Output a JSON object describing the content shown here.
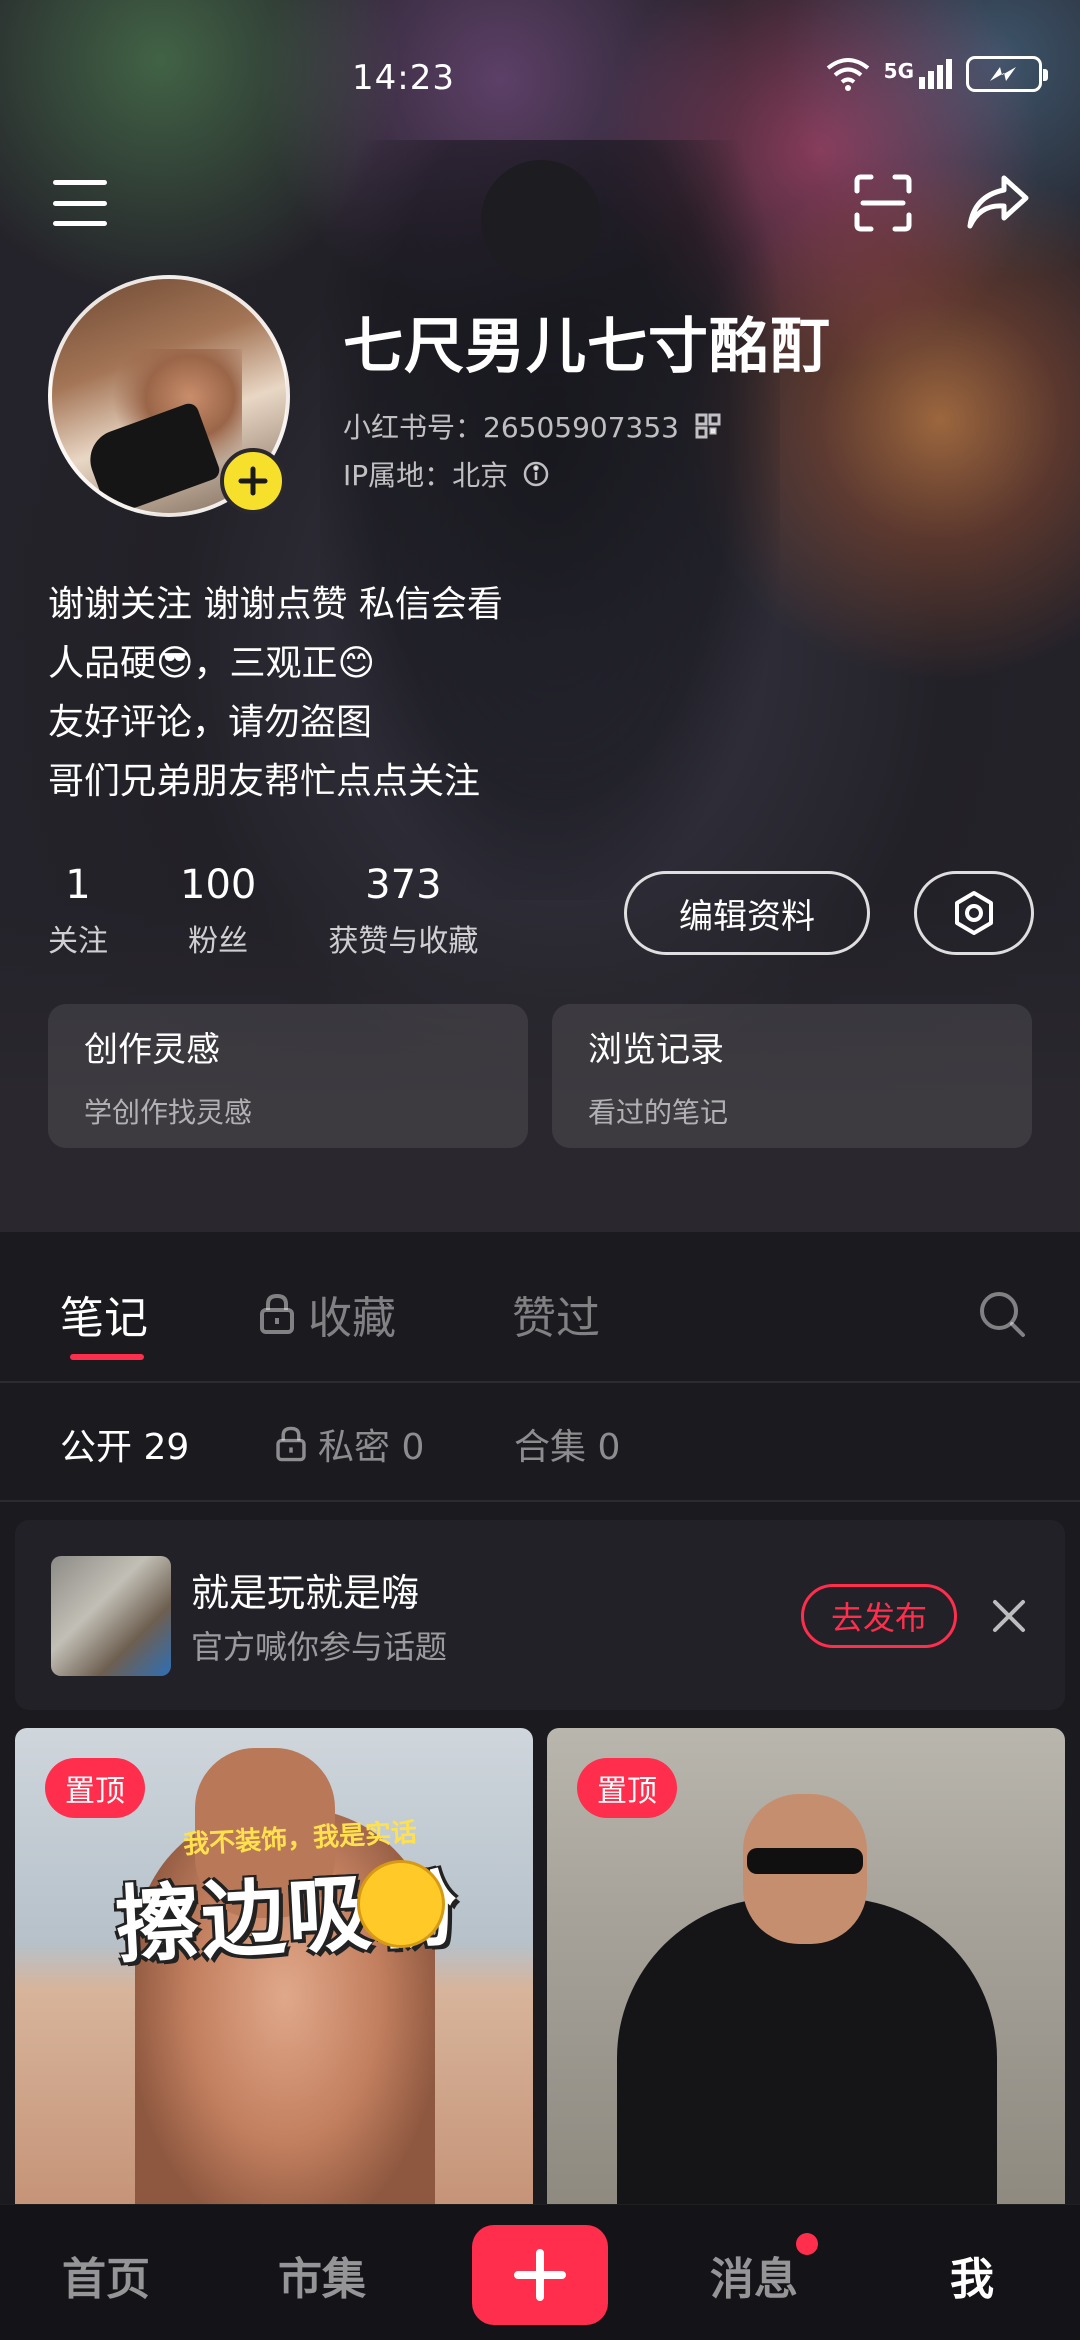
{
  "status_bar": {
    "time": "14:23",
    "network": "5G"
  },
  "profile": {
    "nickname": "七尺男儿七寸酩酊",
    "uid_label": "小红书号：26505907353",
    "ip_label": "IP属地：北京",
    "bio": [
      "谢谢关注 谢谢点赞 私信会看",
      "人品硬😎，三观正😊",
      "友好评论，请勿盗图",
      "哥们兄弟朋友帮忙点点关注"
    ]
  },
  "stats": [
    {
      "num": "1",
      "label": "关注"
    },
    {
      "num": "100",
      "label": "粉丝"
    },
    {
      "num": "373",
      "label": "获赞与收藏"
    }
  ],
  "buttons": {
    "edit_profile": "编辑资料"
  },
  "cards": [
    {
      "title": "创作灵感",
      "sub": "学创作找灵感"
    },
    {
      "title": "浏览记录",
      "sub": "看过的笔记"
    }
  ],
  "tabs": {
    "notes": "笔记",
    "collect": "收藏",
    "liked": "赞过"
  },
  "subtabs": {
    "public": "公开 29",
    "private": "私密 0",
    "albums": "合集 0"
  },
  "banner": {
    "title": "就是玩就是嗨",
    "sub": "官方喊你参与话题",
    "action": "去发布"
  },
  "notes": [
    {
      "pin": "置顶",
      "overlay_small": "我不装饰，我是实话",
      "overlay_big": "擦边吸粉"
    },
    {
      "pin": "置顶"
    }
  ],
  "bottom_nav": {
    "home": "首页",
    "market": "市集",
    "messages": "消息",
    "me": "我"
  },
  "colors": {
    "accent": "#ff2e4d",
    "avatar_plus": "#f6e02b"
  }
}
